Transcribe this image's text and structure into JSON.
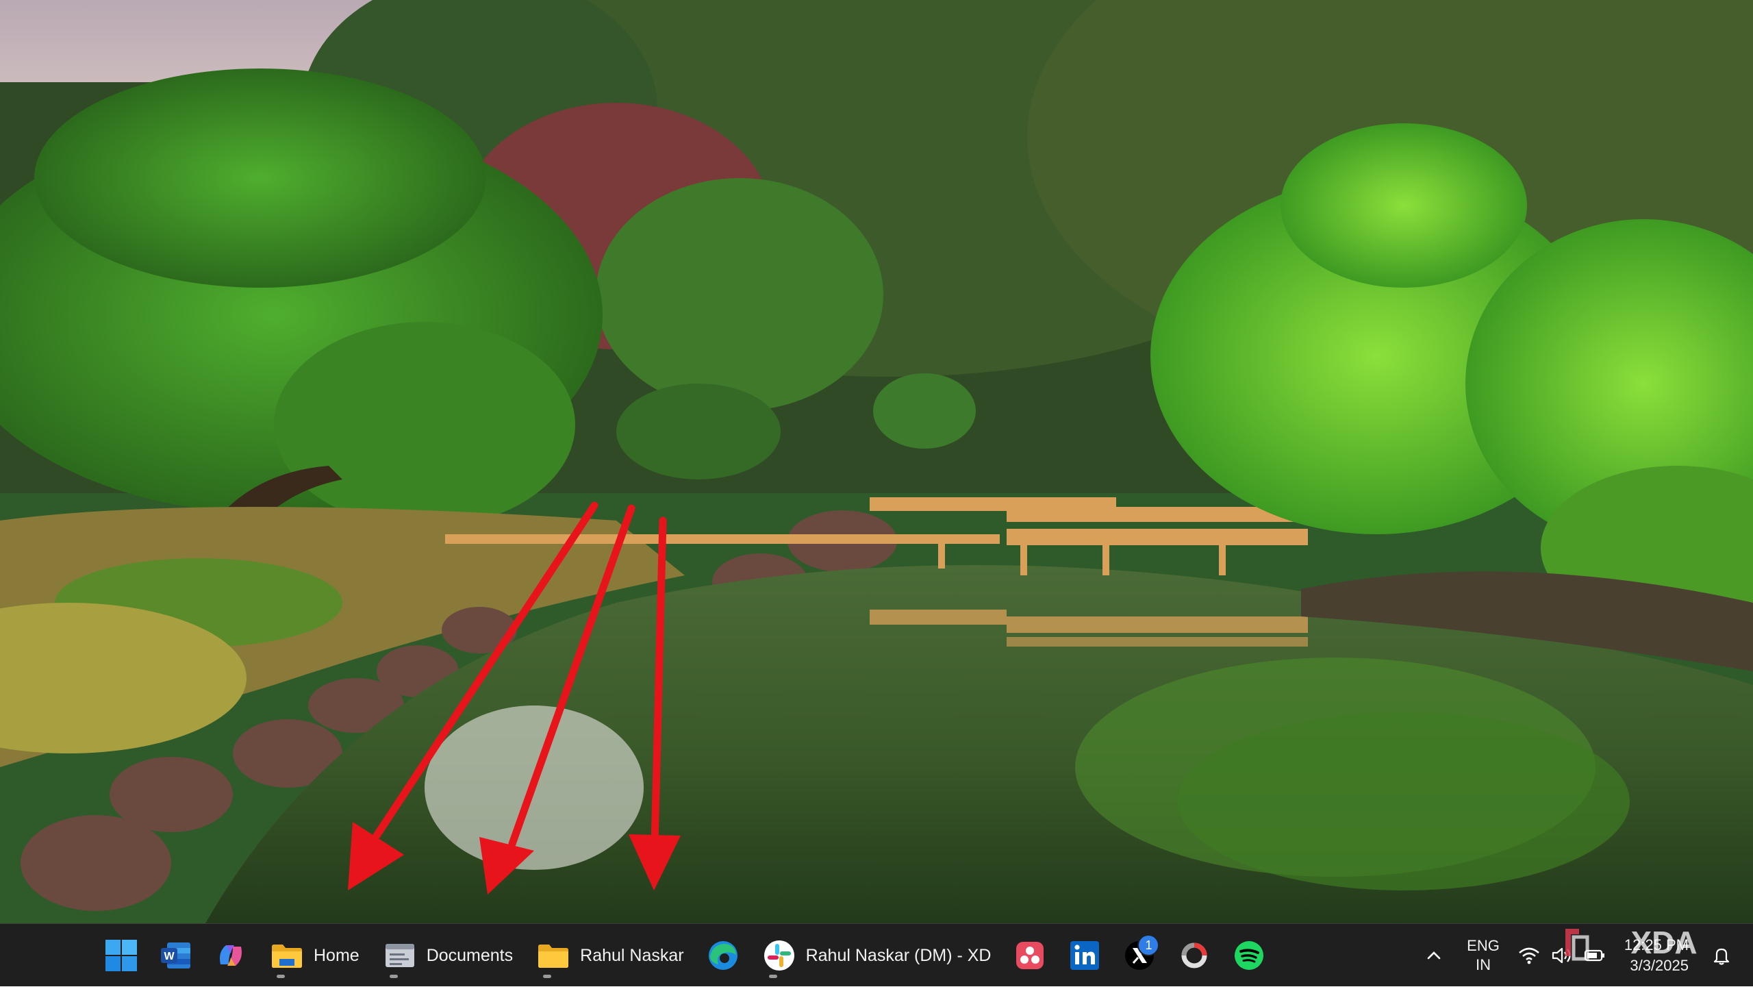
{
  "taskbar": {
    "items": [
      {
        "name": "start",
        "icon": "windows-logo-icon"
      },
      {
        "name": "word",
        "icon": "word-icon"
      },
      {
        "name": "copilot",
        "icon": "copilot-icon"
      },
      {
        "name": "file-explorer-home",
        "icon": "folder-icon",
        "label": "Home"
      },
      {
        "name": "documents",
        "icon": "document-window-icon",
        "label": "Documents"
      },
      {
        "name": "rahul-naskar-folder",
        "icon": "folder-icon",
        "label": "Rahul Naskar"
      },
      {
        "name": "edge",
        "icon": "edge-icon"
      },
      {
        "name": "slack",
        "icon": "slack-icon",
        "label": "Rahul Naskar (DM) - XD"
      },
      {
        "name": "app-red",
        "icon": "app-icon"
      },
      {
        "name": "linkedin",
        "icon": "linkedin-icon"
      },
      {
        "name": "x",
        "icon": "x-icon",
        "badge": "1"
      },
      {
        "name": "ring-app",
        "icon": "ring-icon"
      },
      {
        "name": "spotify",
        "icon": "spotify-icon"
      }
    ],
    "tray": {
      "overflow_icon": "chevron-up-icon",
      "language_line1": "ENG",
      "language_line2": "IN",
      "time": "12:25 PM",
      "date": "3/3/2025"
    }
  },
  "watermark": {
    "text": "XDA"
  },
  "colors": {
    "taskbar_bg": "#1f1f1f",
    "arrow": "#e8141b",
    "accent_blue": "#0a78d7"
  }
}
